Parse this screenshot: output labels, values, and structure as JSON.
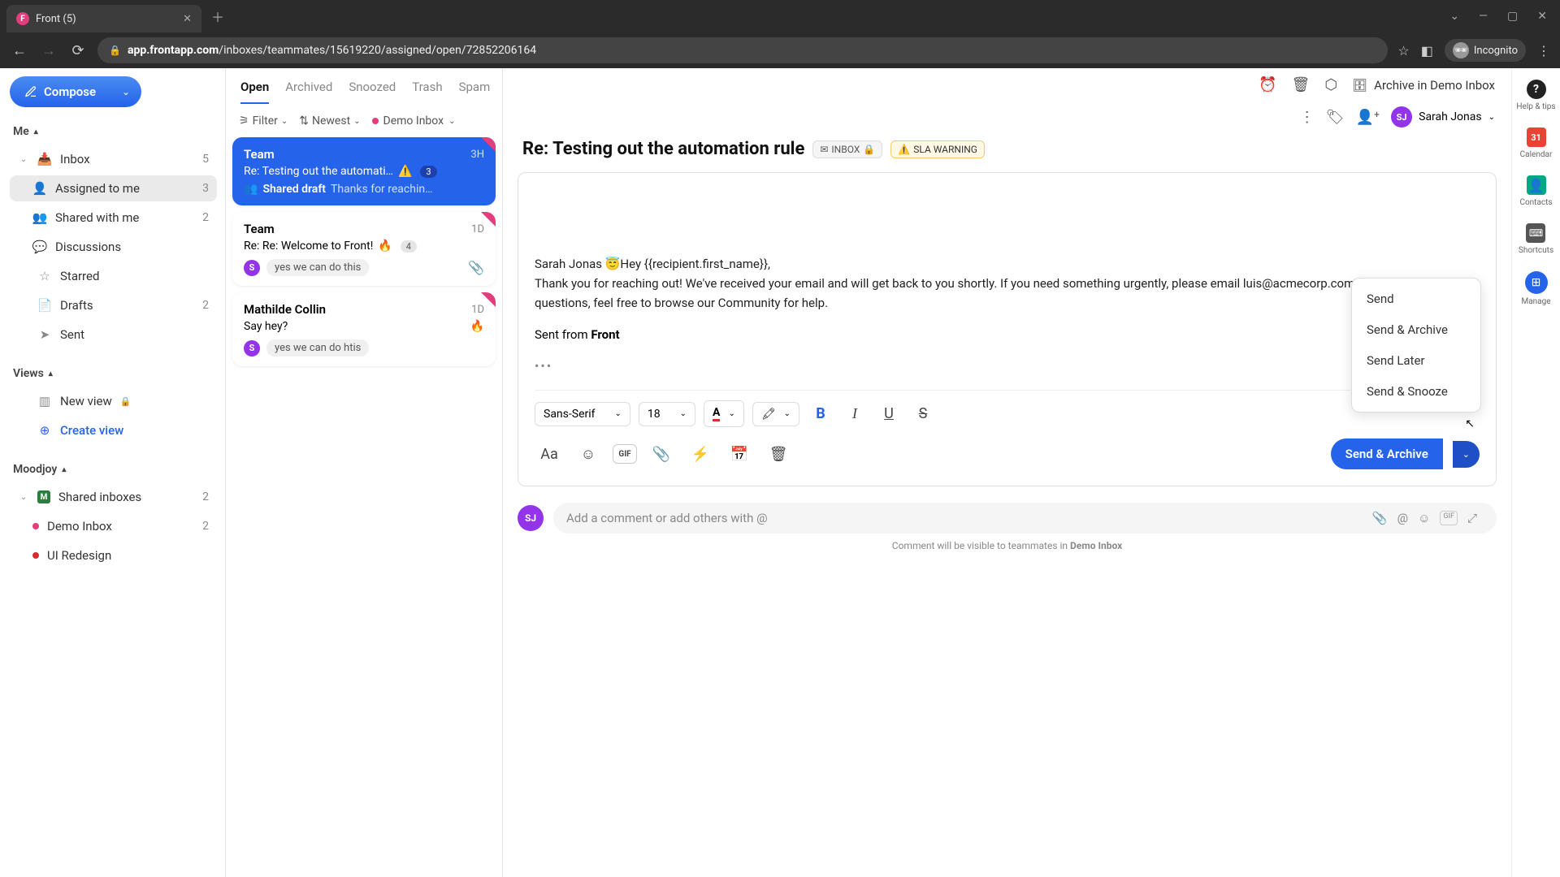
{
  "browser": {
    "tab_title": "Front (5)",
    "url_host": "app.frontapp.com",
    "url_path": "/inboxes/teammates/15619220/assigned/open/72852206164",
    "incognito_label": "Incognito"
  },
  "sidebar": {
    "compose_label": "Compose",
    "sections": {
      "me_label": "Me",
      "views_label": "Views",
      "moodjoy_label": "Moodjoy"
    },
    "items": {
      "inbox": {
        "label": "Inbox",
        "count": "5"
      },
      "assigned": {
        "label": "Assigned to me",
        "count": "3"
      },
      "shared_with_me": {
        "label": "Shared with me",
        "count": "2"
      },
      "discussions": {
        "label": "Discussions"
      },
      "starred": {
        "label": "Starred"
      },
      "drafts": {
        "label": "Drafts",
        "count": "2"
      },
      "sent": {
        "label": "Sent"
      },
      "new_view": {
        "label": "New view"
      },
      "create_view": {
        "label": "Create view"
      },
      "shared_inboxes": {
        "label": "Shared inboxes",
        "count": "2"
      },
      "demo_inbox": {
        "label": "Demo Inbox",
        "count": "2"
      },
      "ui_redesign": {
        "label": "UI Redesign"
      }
    }
  },
  "conv_tabs": {
    "open": "Open",
    "archived": "Archived",
    "snoozed": "Snoozed",
    "trash": "Trash",
    "spam": "Spam"
  },
  "filters": {
    "filter_label": "Filter",
    "sort_label": "Newest",
    "scope_label": "Demo Inbox"
  },
  "conversations": [
    {
      "from": "Team",
      "time": "3H",
      "subject": "Re: Testing out the automati…",
      "warn": "⚠️",
      "count": "3",
      "draft_label": "Shared draft",
      "draft_preview": "Thanks for reachin…"
    },
    {
      "from": "Team",
      "time": "1D",
      "subject": "Re: Re: Welcome to Front!",
      "fire": "🔥",
      "count": "4",
      "avatar": "S",
      "tag": "yes we can do this",
      "has_attachment": true
    },
    {
      "from": "Mathilde Collin",
      "time": "1D",
      "subject": "Say hey?",
      "fire": "🔥",
      "avatar": "S",
      "tag": "yes we can do htis"
    }
  ],
  "main": {
    "archive_button": "Archive in Demo Inbox",
    "assignee": "Sarah Jonas",
    "assignee_initials": "SJ",
    "subject": "Re: Testing out the automation rule",
    "inbox_pill": "INBOX",
    "sla_pill": "SLA WARNING",
    "body_line1": "Sarah Jonas 😇Hey {{recipient.first_name}},",
    "body_line2": "Thank you for reaching out! We've received your email and will get back to you shortly. If you need something urgently, please email luis@acmecorp.com, and if you have questions, feel free to browse our Community for help.",
    "sig_prefix": "Sent from ",
    "sig_brand": "Front",
    "font_family": "Sans-Serif",
    "font_size": "18",
    "send_button": "Send & Archive",
    "send_menu": [
      "Send",
      "Send & Archive",
      "Send Later",
      "Send & Snooze"
    ],
    "comment_placeholder": "Add a comment or add others with @",
    "comment_hint_prefix": "Comment will be visible to teammates in ",
    "comment_hint_inbox": "Demo Inbox"
  },
  "rail": {
    "help": "Help & tips",
    "calendar": "Calendar",
    "contacts": "Contacts",
    "shortcuts": "Shortcuts",
    "manage": "Manage",
    "cal_day": "31"
  }
}
